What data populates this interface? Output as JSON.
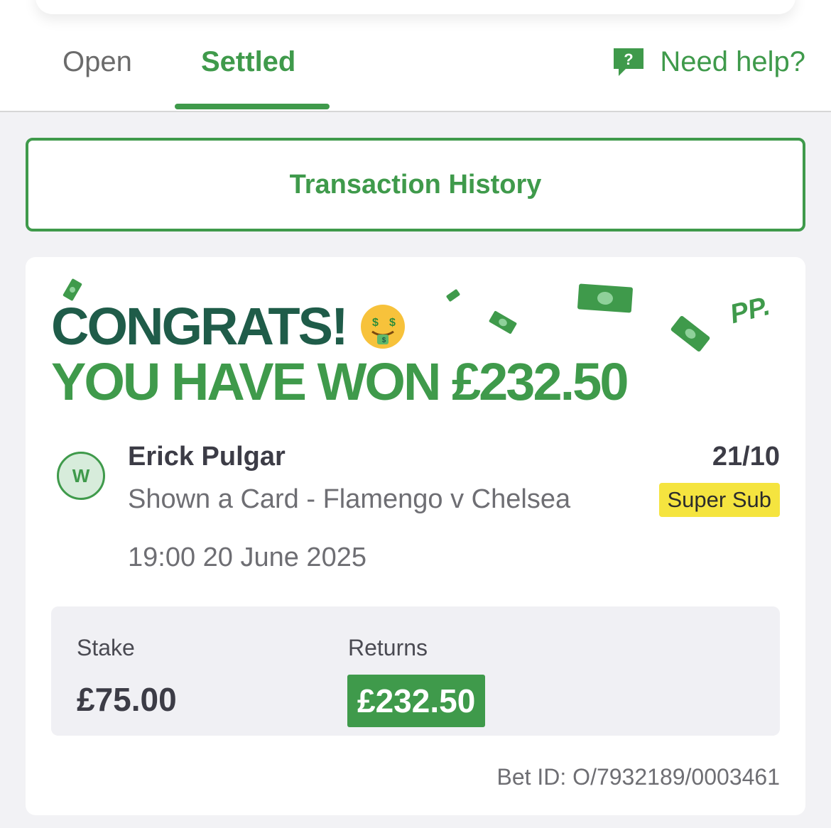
{
  "tabs": {
    "open_label": "Open",
    "settled_label": "Settled",
    "active": "Settled"
  },
  "help": {
    "label": "Need help?",
    "icon": "help-chat-icon"
  },
  "transaction_history_label": "Transaction History",
  "bet_card": {
    "congrats_text": "CONGRATS!",
    "emoji": "money-mouth-face",
    "won_text": "YOU HAVE WON £232.50",
    "brand_logo": "PP.",
    "result_badge": "W",
    "selection": "Erick Pulgar",
    "market_event": "Shown a Card - Flamengo v Chelsea",
    "event_datetime": "19:00 20 June 2025",
    "odds": "21/10",
    "promo_tag": "Super Sub",
    "stake_label": "Stake",
    "stake_value": "£75.00",
    "returns_label": "Returns",
    "returns_value": "£232.50",
    "bet_id": "Bet ID: O/7932189/0003461"
  },
  "colors": {
    "brand_green": "#3f9a4b",
    "dark_green": "#1f5c49",
    "promo_yellow": "#f5e43f"
  }
}
